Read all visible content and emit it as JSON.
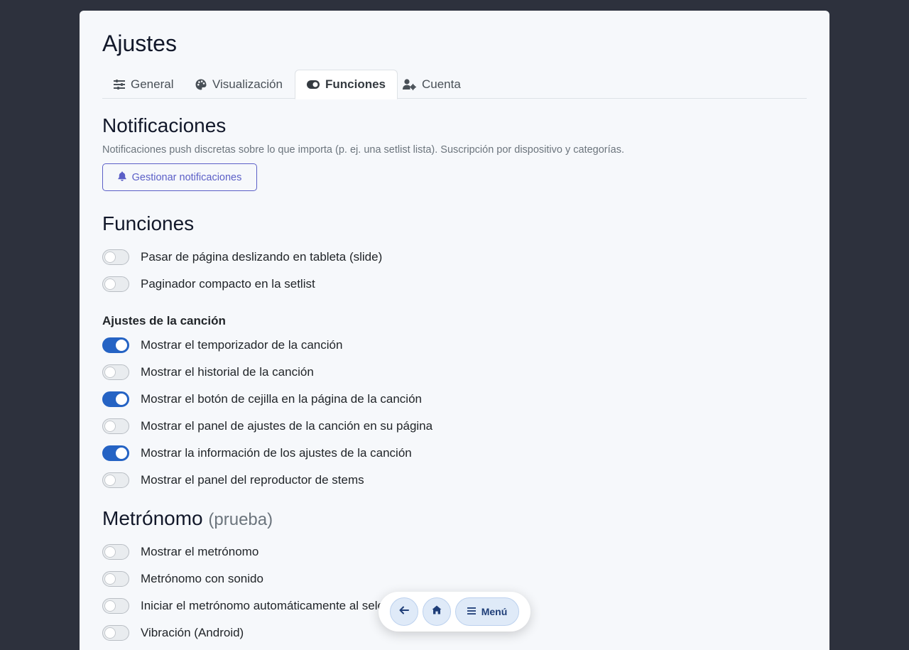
{
  "page": {
    "title": "Ajustes"
  },
  "tabs": [
    {
      "label": "General",
      "icon": "sliders-icon",
      "active": false
    },
    {
      "label": "Visualización",
      "icon": "palette-icon",
      "active": false
    },
    {
      "label": "Funciones",
      "icon": "toggle-icon",
      "active": true
    },
    {
      "label": "Cuenta",
      "icon": "user-gear-icon",
      "active": false
    }
  ],
  "notifications": {
    "title": "Notificaciones",
    "description": "Notificaciones push discretas sobre lo que importa (p. ej. una setlist lista). Suscripción por dispositivo y categorías.",
    "button_label": "Gestionar notificaciones",
    "button_icon": "bell-icon"
  },
  "functions": {
    "title": "Funciones",
    "items": [
      {
        "label": "Pasar de página deslizando en tableta (slide)",
        "on": false
      },
      {
        "label": "Paginador compacto en la setlist",
        "on": false
      }
    ]
  },
  "song_settings": {
    "title": "Ajustes de la canción",
    "items": [
      {
        "label": "Mostrar el temporizador de la canción",
        "on": true
      },
      {
        "label": "Mostrar el historial de la canción",
        "on": false
      },
      {
        "label": "Mostrar el botón de cejilla en la página de la canción",
        "on": true
      },
      {
        "label": "Mostrar el panel de ajustes de la canción en su página",
        "on": false
      },
      {
        "label": "Mostrar la información de los ajustes de la canción",
        "on": true
      },
      {
        "label": "Mostrar el panel del reproductor de stems",
        "on": false
      }
    ]
  },
  "metronome": {
    "title": "Metrónomo",
    "title_suffix": "(prueba)",
    "items": [
      {
        "label": "Mostrar el metrónomo",
        "on": false
      },
      {
        "label": "Metrónomo con sonido",
        "on": false
      },
      {
        "label": "Iniciar el metrónomo automáticamente al selecc",
        "on": false
      },
      {
        "label": "Vibración (Android)",
        "on": false
      }
    ]
  },
  "bottom_nav": {
    "back_icon": "arrow-left-icon",
    "home_icon": "home-icon",
    "menu_icon": "hamburger-icon",
    "menu_label": "Menú"
  },
  "colors": {
    "background": "#2d313d",
    "card": "#f6f8fb",
    "switch_on": "#2563c4",
    "accent": "#5b5fc7"
  }
}
